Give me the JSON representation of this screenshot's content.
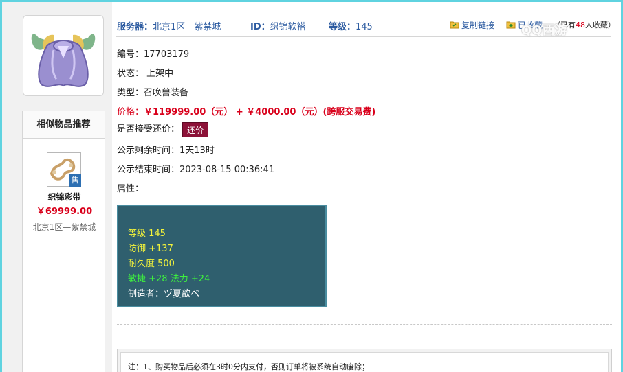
{
  "header": {
    "server_label": "服务器：",
    "server_value": "北京1区—紫禁城",
    "id_label": "ID：",
    "id_value": "织锦软褡",
    "level_label": "等级：",
    "level_value": "145",
    "copy_link": "复制链接",
    "favorited": "已收藏",
    "fav_prefix": "（已有",
    "fav_count": "48",
    "fav_suffix": "人收藏）"
  },
  "watermark": "QQ西游",
  "details": {
    "number_label": "编号：",
    "number_value": "17703179",
    "status_label": "状态：",
    "status_value": "上架中",
    "type_label": "类型：",
    "type_value": "召唤兽装备",
    "price_label": "价格：",
    "price_value": "￥119999.00（元） +  ￥4000.00（元）(跨服交易费)",
    "counter_label": "是否接受还价：",
    "counter_button": "还价",
    "remaining_label": "公示剩余时间：",
    "remaining_value": "1天13时",
    "end_label": "公示结束时间：",
    "end_value": "2023-08-15 00:36:41",
    "attr_label": "属性："
  },
  "attributes": [
    {
      "text": "等级 145",
      "color": "#f3f33b"
    },
    {
      "text": "防御 +137",
      "color": "#f3f33b"
    },
    {
      "text": "耐久度 500",
      "color": "#f3f33b"
    },
    {
      "text": "敏捷 +28 法力 +24",
      "color": "#3ef23e"
    },
    {
      "text": "制造者：ヅ夏歆べ",
      "color": "#ffffff"
    }
  ],
  "similar": {
    "title": "相似物品推荐",
    "item_name": "织锦彩带",
    "item_price": "￥69999.00",
    "item_server": "北京1区—紫禁城",
    "sale_badge": "售"
  },
  "note": "注：1、购买物品后必须在3时0分内支付，否则订单将被系统自动废除；",
  "colors": {
    "accent_blue": "#2b5aa0",
    "price_red": "#d9001b",
    "counter_button": "#8c1238",
    "attr_panel": "#2f5f6e",
    "frame_cyan": "#5fd3e0"
  }
}
